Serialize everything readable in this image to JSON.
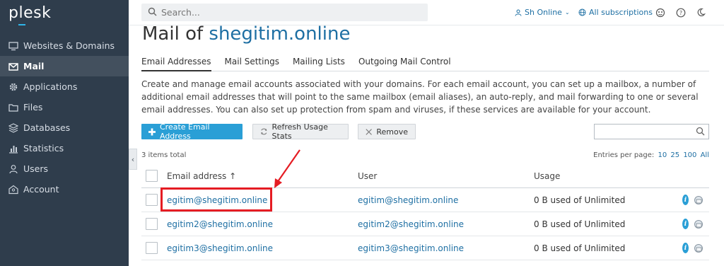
{
  "sidebar": {
    "logo": "plesk",
    "items": [
      {
        "label": "Websites & Domains",
        "icon": "monitor-icon"
      },
      {
        "label": "Mail",
        "icon": "envelope-icon",
        "active": true
      },
      {
        "label": "Applications",
        "icon": "gear-icon"
      },
      {
        "label": "Files",
        "icon": "folder-icon"
      },
      {
        "label": "Databases",
        "icon": "database-icon"
      },
      {
        "label": "Statistics",
        "icon": "bar-chart-icon"
      },
      {
        "label": "Users",
        "icon": "user-icon"
      },
      {
        "label": "Account",
        "icon": "account-icon"
      }
    ],
    "collapse_glyph": "‹"
  },
  "topbar": {
    "search_placeholder": "Search...",
    "user_label": "Sh Online",
    "subscriptions_label": "All subscriptions"
  },
  "page": {
    "title_prefix": "Mail of ",
    "title_domain": "shegitim.online",
    "tabs": [
      "Email Addresses",
      "Mail Settings",
      "Mailing Lists",
      "Outgoing Mail Control"
    ],
    "active_tab": "Email Addresses",
    "description": "Create and manage email accounts associated with your domains. For each email account, you can set up a mailbox, a number of additional email addresses that will point to the same mailbox (email aliases), an auto-reply, and mail forwarding to one or several email addresses. You can also set up protection from spam and viruses, if these services are available for your account."
  },
  "toolbar": {
    "create_label": "Create Email Address",
    "refresh_label": "Refresh Usage Stats",
    "remove_label": "Remove"
  },
  "list": {
    "items_total": "3 items total",
    "per_page_label": "Entries per page:",
    "per_page_options": [
      "10",
      "25",
      "100",
      "All"
    ],
    "columns": {
      "email": "Email address ↑",
      "user": "User",
      "usage": "Usage"
    },
    "rows": [
      {
        "email": "egitim@shegitim.online",
        "user": "egitim@shegitim.online",
        "usage": "0 B used of Unlimited"
      },
      {
        "email": "egitim2@shegitim.online",
        "user": "egitim2@shegitim.online",
        "usage": "0 B used of Unlimited"
      },
      {
        "email": "egitim3@shegitim.online",
        "user": "egitim3@shegitim.online",
        "usage": "0 B used of Unlimited"
      }
    ]
  },
  "colors": {
    "sidebar_bg": "#2f3d4c",
    "active_item_bg": "#43505e",
    "link": "#1e6fa3",
    "primary_button": "#2a9fd6",
    "annotation_red": "#e51c23"
  }
}
